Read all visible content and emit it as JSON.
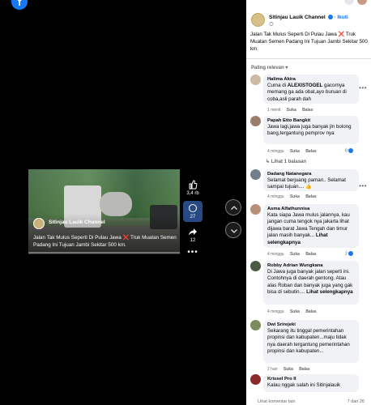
{
  "video": {
    "channel": "Sitinjau Lauik Channel",
    "caption_pre": "Jalan Tak Mulus Seperti Di Pulau Jawa",
    "caption_post": "Truk Muatan Semen Padang Ini Tujuan Jambi Sekitar 500 km.",
    "progress": 0.0
  },
  "rail": {
    "likes": "3,4 rb",
    "comments": "27",
    "shares": "12"
  },
  "post": {
    "author": "Sitinjau Lauik Channel",
    "follow": "· Ikuti",
    "caption": "Jalan Tak Mulus Seperti Di Pulau Jawa ❌ Truk Muatan Semen Padang Ini Tujuan Jambi Sekitar 500 km."
  },
  "sort_label": "Paling relevan ▾",
  "comments": [
    {
      "author": "Halima Akira",
      "text_pre": "Cuma di ",
      "text_bold": "ALEXISTOGEL",
      "text_post": " gacornya memang ga ada obat,ayo buruan di coba,asli parah dah",
      "time": "1 menit",
      "like": "Suka",
      "reply": "Balas",
      "avatar_color": "#cfb8a4"
    },
    {
      "author": "Papah Etto Bangkit",
      "text": "Jawa lagi,jawa juga banyak jln bolong bang,tergantung pemprov nya",
      "time": "4 minggu",
      "like": "Suka",
      "reply": "Balas",
      "reactions": "8",
      "replies_link": "Lihat 1 balasan",
      "avatar_color": "#9b7d6a"
    },
    {
      "author": "Dadang Natanegara",
      "text": "Selamat berjuang paman.. Selamat sampai tujuan.... 👍",
      "time": "4 minggu",
      "like": "Suka",
      "reply": "Balas",
      "avatar_color": "#6f7f8c"
    },
    {
      "author": "Asma Alfathunnisa",
      "text": "Kata siapa Jawa mulus jalannya, kau jangan cuma tengok nya jakarta lihat dijawa barat Jawa Tengah dan timur jalan masih banyak...",
      "see_more": "Lihat selengkapnya",
      "time": "4 minggu",
      "like": "Suka",
      "reply": "Balas",
      "reactions": "2",
      "avatar_color": "#b98f76"
    },
    {
      "author": "Robby Adrian Wungkana",
      "text": "Di Jawa juga banyak jalan seperti ini. Contohnya di daerah gentong. Atau alas Roban dan banyak juga yang gak bisa di sebutin....",
      "see_more": "Lihat selengkapnya",
      "time": "4 minggu",
      "like": "Suka",
      "reply": "Balas",
      "avatar_color": "#4b5a44"
    },
    {
      "author": "Dwi Srirejeki",
      "text": "Sekarang itu tinggal pemerintahan propinsi dan kabupaten...maju tidak nya daerah tergantung pemerintahan propinsi dan kabupaten...",
      "time": "2 hari",
      "like": "Suka",
      "reply": "Balas",
      "avatar_color": "#7a8b5c"
    },
    {
      "author": "Krissel Pro II",
      "text": "Kalau nggak salah ini Sitinjalauik",
      "time": "",
      "like": "",
      "reply": "",
      "avatar_color": "#8a2a2a"
    }
  ],
  "footer": {
    "left": "Lihat komentar lain",
    "right": "7 dari 26"
  },
  "colors": {
    "accent": "#1877f2",
    "comment_bg": "#f0f2f5",
    "muted": "#65676b"
  }
}
